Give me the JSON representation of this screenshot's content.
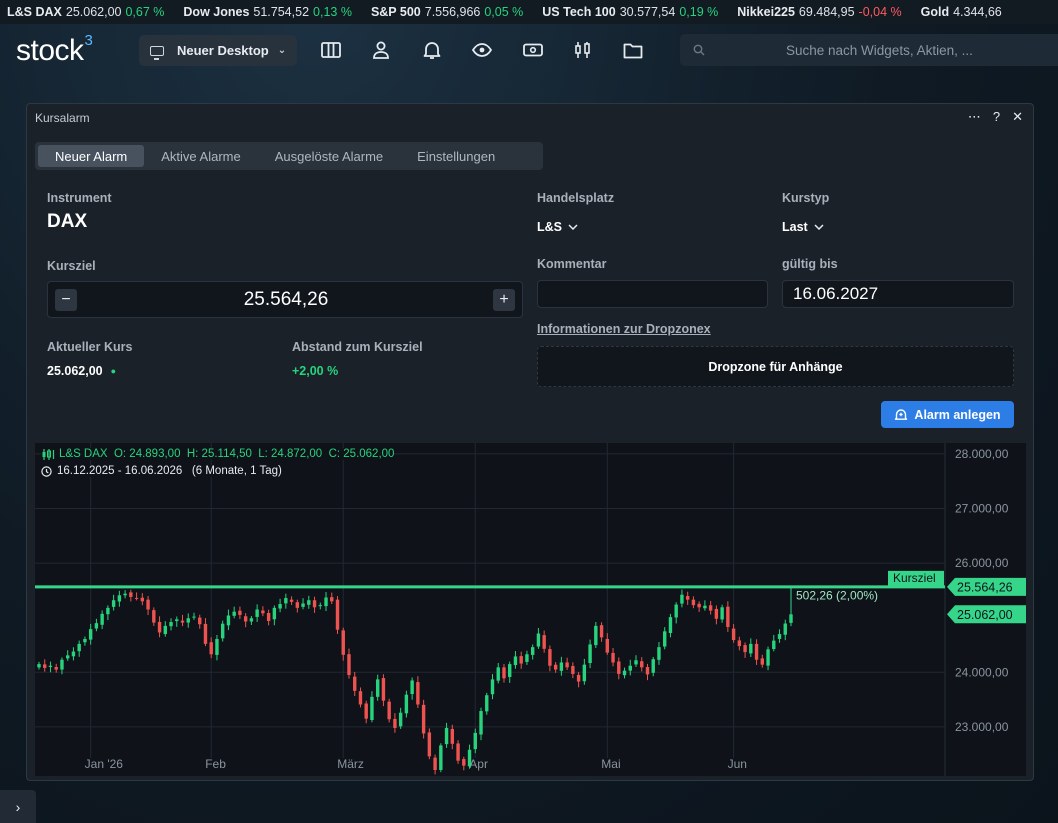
{
  "ticker": [
    {
      "name": "L&S DAX",
      "value": "25.062,00",
      "change": "0,67 %",
      "dir": "pos"
    },
    {
      "name": "Dow Jones",
      "value": "51.754,52",
      "change": "0,13 %",
      "dir": "pos"
    },
    {
      "name": "S&P 500",
      "value": "7.556,966",
      "change": "0,05 %",
      "dir": "pos"
    },
    {
      "name": "US Tech 100",
      "value": "30.577,54",
      "change": "0,19 %",
      "dir": "pos"
    },
    {
      "name": "Nikkei225",
      "value": "69.484,95",
      "change": "-0,04 %",
      "dir": "neg"
    },
    {
      "name": "Gold",
      "value": "4.344,66",
      "change": "",
      "dir": "neg"
    }
  ],
  "header": {
    "logo": "stock",
    "logo_sup": "3",
    "desktop_label": "Neuer Desktop",
    "search_placeholder": "Suche nach Widgets, Aktien, ..."
  },
  "window": {
    "title": "Kursalarm",
    "tabs": [
      {
        "label": "Neuer Alarm",
        "active": true
      },
      {
        "label": "Aktive Alarme",
        "active": false
      },
      {
        "label": "Ausgelöste Alarme",
        "active": false
      },
      {
        "label": "Einstellungen",
        "active": false
      }
    ]
  },
  "form": {
    "instrument_label": "Instrument",
    "instrument_value": "DAX",
    "handelsplatz_label": "Handelsplatz",
    "handelsplatz_value": "L&S",
    "kurstyp_label": "Kurstyp",
    "kurstyp_value": "Last",
    "kursziel_label": "Kursziel",
    "kursziel_value": "25.564,26",
    "kommentar_label": "Kommentar",
    "kommentar_value": "",
    "gueltig_label": "gültig bis",
    "gueltig_value": "16.06.2027",
    "aktueller_label": "Aktueller Kurs",
    "aktueller_value": "25.062,00",
    "abstand_label": "Abstand zum Kursziel",
    "abstand_value": "+2,00 %",
    "info_link": "Informationen zur Dropzonex",
    "dropzone": "Dropzone für Anhänge",
    "alarm_button": "Alarm anlegen"
  },
  "chart_data": {
    "type": "candlestick",
    "legend_ohlc": "L&S DAX  O: 24.893,00  H: 25.114,50  L: 24.872,00  C: 25.062,00",
    "legend_range": "16.12.2025 - 16.06.2026   (6 Monate, 1 Tag)",
    "y_ticks": [
      "28.000,00",
      "27.000,00",
      "26.000,00",
      "24.000,00",
      "23.000,00"
    ],
    "x_ticks": [
      "Jan '26",
      "Feb",
      "März",
      "Apr",
      "Mai",
      "Jun"
    ],
    "ylim": [
      22100,
      28200
    ],
    "target": 25564.26,
    "target_label": "Kursziel",
    "target_price_label": "25.564,26",
    "current": 25062.0,
    "current_price_label": "25.062,00",
    "distance_label": "502,26 (2,00%)",
    "colors": {
      "up": "#27d37d",
      "down": "#ef5350",
      "target": "#36d68a"
    },
    "closes": [
      24150,
      24080,
      24120,
      24050,
      24230,
      24310,
      24380,
      24520,
      24610,
      24790,
      24900,
      25070,
      25180,
      25320,
      25410,
      25440,
      25380,
      25360,
      25300,
      25150,
      24910,
      24730,
      24850,
      24920,
      24970,
      24910,
      24990,
      25020,
      24880,
      24520,
      24330,
      24610,
      24890,
      25040,
      25110,
      25050,
      24930,
      24990,
      25150,
      25080,
      24940,
      25180,
      25250,
      25360,
      25290,
      25180,
      25260,
      25320,
      25190,
      25230,
      25370,
      25300,
      24780,
      24320,
      23950,
      23660,
      23410,
      23150,
      23550,
      23870,
      23480,
      23140,
      22980,
      23260,
      23590,
      23850,
      23410,
      22880,
      22460,
      22210,
      22660,
      22980,
      22690,
      22380,
      22290,
      22580,
      22890,
      23290,
      23580,
      23870,
      24090,
      23890,
      24150,
      24290,
      24160,
      24330,
      24460,
      24710,
      24430,
      24120,
      24050,
      24180,
      24090,
      23970,
      23830,
      24140,
      24510,
      24850,
      24640,
      24360,
      24180,
      23970,
      24030,
      24120,
      24220,
      24090,
      23960,
      24240,
      24460,
      24750,
      25010,
      25240,
      25420,
      25330,
      25230,
      25190,
      25220,
      25130,
      24980,
      25190,
      24830,
      24590,
      24480,
      24370,
      24520,
      24230,
      24140,
      24420,
      24580,
      24700,
      24893,
      25062
    ]
  }
}
